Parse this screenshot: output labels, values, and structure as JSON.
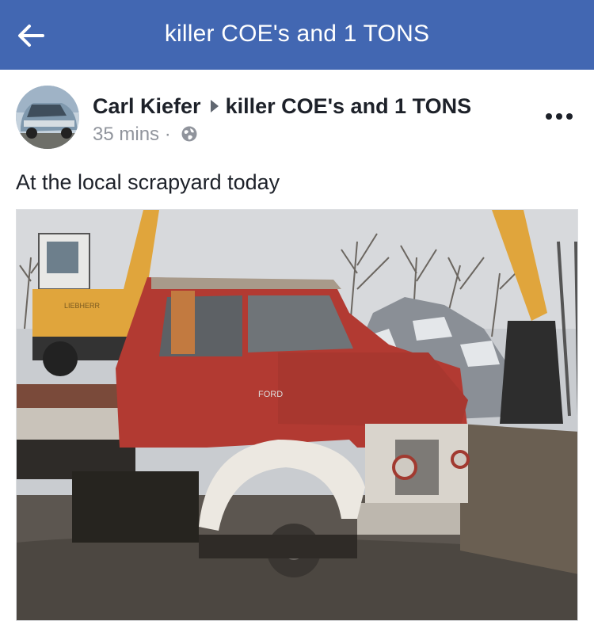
{
  "header": {
    "title": "killer COE's and 1 TONS",
    "back_icon": "arrow-left-icon",
    "background_color": "#4267b2"
  },
  "post": {
    "author": "Carl Kiefer",
    "group": "killer COE's and 1 TONS",
    "time": "35 mins",
    "separator": "·",
    "privacy_icon": "globe-icon",
    "more_icon": "more-horizontal-icon",
    "caption": "At the local scrapyard today",
    "photo": {
      "truck_cab_text": "FORD",
      "excavator_text": "LIEBHERR"
    }
  }
}
